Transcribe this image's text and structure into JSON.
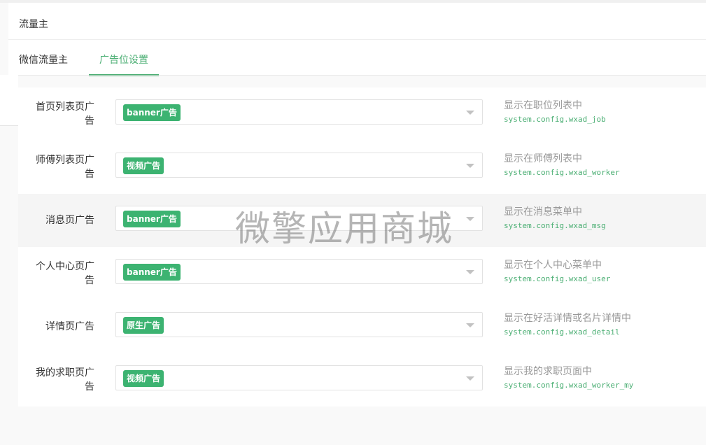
{
  "panel": {
    "title": "流量主"
  },
  "tabs": [
    {
      "label": "微信流量主",
      "active": false
    },
    {
      "label": "广告位设置",
      "active": true
    }
  ],
  "rows": [
    {
      "label": "首页列表页广告",
      "value": "banner广告",
      "help": "显示在职位列表中",
      "config": "system.config.wxad_job"
    },
    {
      "label": "师傅列表页广告",
      "value": "视频广告",
      "help": "显示在师傅列表中",
      "config": "system.config.wxad_worker"
    },
    {
      "label": "消息页广告",
      "value": "banner广告",
      "help": "显示在消息菜单中",
      "config": "system.config.wxad_msg"
    },
    {
      "label": "个人中心页广告",
      "value": "banner广告",
      "help": "显示在个人中心菜单中",
      "config": "system.config.wxad_user"
    },
    {
      "label": "详情页广告",
      "value": "原生广告",
      "help": "显示在好活详情或名片详情中",
      "config": "system.config.wxad_detail"
    },
    {
      "label": "我的求职页广告",
      "value": "视频广告",
      "help": "显示我的求职页面中",
      "config": "system.config.wxad_worker_my"
    }
  ],
  "watermark": "微擎应用商城",
  "colors": {
    "accent": "#4caf74",
    "tag": "#3cb371"
  }
}
